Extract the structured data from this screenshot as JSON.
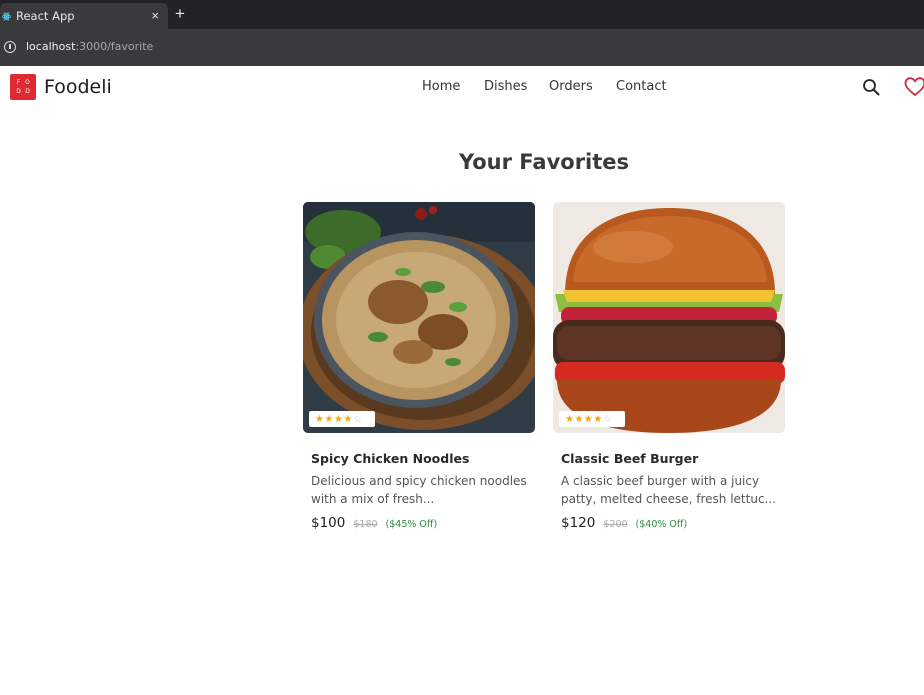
{
  "browser": {
    "tab_title": "React App",
    "tab_close": "×",
    "new_tab": "+",
    "url_host": "localhost",
    "url_path": ":3000/favorite"
  },
  "header": {
    "logo_letters": [
      "F",
      "O",
      "D",
      "D"
    ],
    "brand": "Foodeli",
    "nav": [
      "Home",
      "Dishes",
      "Orders",
      "Contact"
    ],
    "accent_color": "#e02a33"
  },
  "page": {
    "title": "Your Favorites"
  },
  "favorites": [
    {
      "name": "Spicy Chicken Noodles",
      "description": "Delicious and spicy chicken noodles with a mix of fresh...",
      "price": "$100",
      "old_price": "$180",
      "discount": "($45% Off)",
      "rating_stars": "★★★★",
      "rating_empty": "☆",
      "rating_filled": 4,
      "rating_max": 5,
      "image": "noodles-bowl"
    },
    {
      "name": "Classic Beef Burger",
      "description": "A classic beef burger with a juicy patty, melted cheese, fresh lettuc...",
      "price": "$120",
      "old_price": "$200",
      "discount": "($40% Off)",
      "rating_stars": "★★★★",
      "rating_empty": "☆",
      "rating_filled": 4,
      "rating_max": 5,
      "image": "beef-burger"
    }
  ]
}
